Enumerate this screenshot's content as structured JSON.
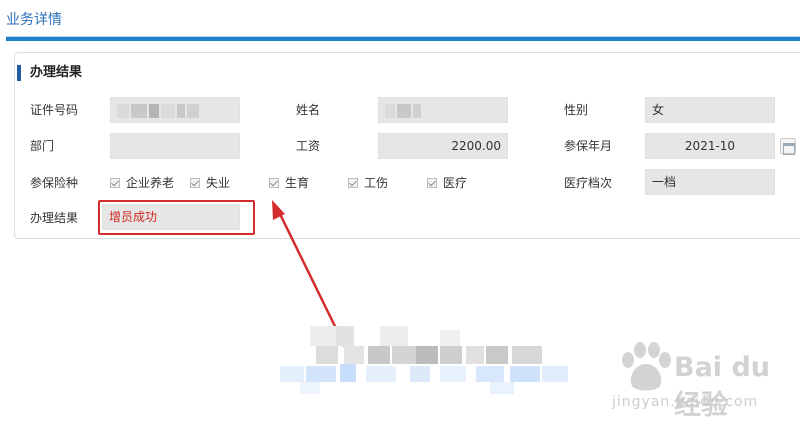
{
  "header": {
    "title": "业务详情"
  },
  "section": {
    "title": "办理结果"
  },
  "fields": {
    "id_number": {
      "label": "证件号码"
    },
    "name": {
      "label": "姓名"
    },
    "gender": {
      "label": "性别",
      "value": "女"
    },
    "department": {
      "label": "部门",
      "value": ""
    },
    "salary": {
      "label": "工资",
      "value": "2200.00"
    },
    "insured_month": {
      "label": "参保年月",
      "value": "2021-10"
    },
    "insurance_types": {
      "label": "参保险种",
      "items": [
        "企业养老",
        "失业",
        "生育",
        "工伤",
        "医疗"
      ]
    },
    "medical_grade": {
      "label": "医疗档次",
      "value": "一档"
    },
    "result": {
      "label": "办理结果",
      "value": "增员成功"
    }
  },
  "watermark": {
    "brand": "Bai du 经验",
    "url": "jingyan.baidu.com"
  },
  "colors": {
    "accent": "#1f7fc7",
    "highlight": "#d42c2c",
    "result_text": "#d0281f"
  }
}
